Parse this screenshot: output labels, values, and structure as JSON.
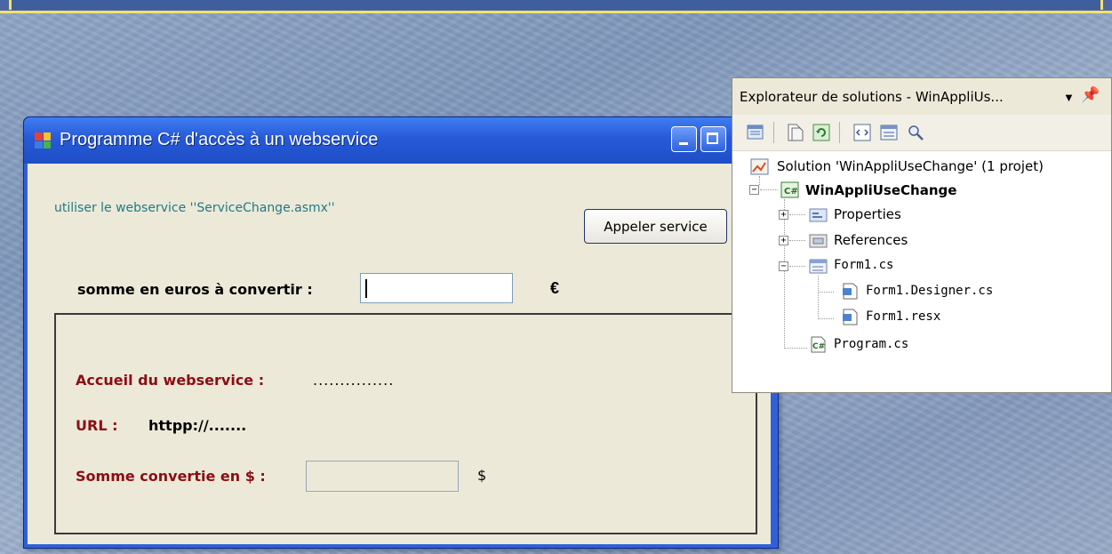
{
  "form": {
    "title": "Programme C# d'accès à un webservice",
    "info_text": "utiliser le webservice ''ServiceChange.asmx''",
    "call_button": "Appeler service",
    "amount_label": "somme  en euros à convertir :",
    "amount_value": "",
    "euro_symbol": "€",
    "welcome_label": "Accueil du webservice :",
    "welcome_value": "...............",
    "url_label": "URL :",
    "url_value": "httpp://.......",
    "converted_label": "Somme convertie en $ :",
    "converted_value": "",
    "dollar_symbol": "$"
  },
  "explorer": {
    "title": "Explorateur de solutions - WinAppliUs...",
    "toolbar_icons": [
      "properties-icon",
      "show-all-files-icon",
      "refresh-icon",
      "view-code-icon",
      "view-designer-icon",
      "class-view-icon"
    ],
    "solution": "Solution 'WinAppliUseChange' (1 projet)",
    "project": "WinAppliUseChange",
    "properties": "Properties",
    "references": "References",
    "form1": "Form1.cs",
    "form1_designer": "Form1.Designer.cs",
    "form1_resx": "Form1.resx",
    "program": "Program.cs"
  },
  "colors": {
    "title_bar": "#2759d8",
    "form_bg": "#ece9d8",
    "label_red": "#8b0d14",
    "info_teal": "#1f7a86",
    "banner_yellow": "#f3e16a"
  }
}
